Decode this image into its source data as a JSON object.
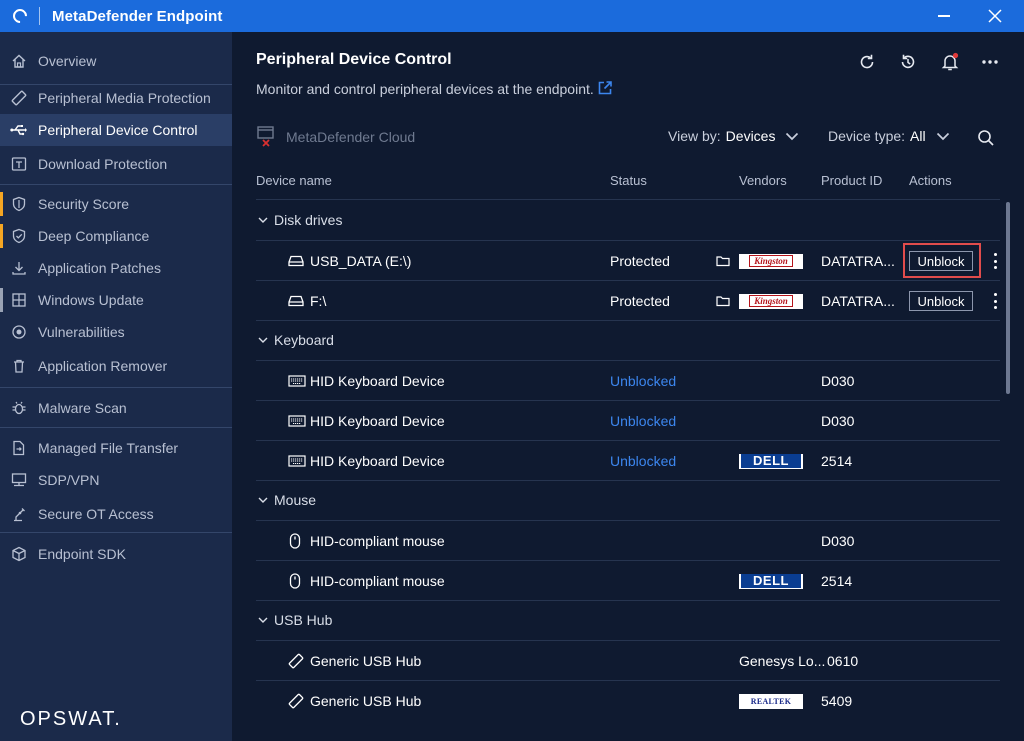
{
  "app": {
    "title": "MetaDefender Endpoint",
    "brand": "OPSWAT."
  },
  "sidebar": {
    "items": [
      {
        "label": "Overview",
        "icon": "home-icon"
      },
      {
        "label": "Peripheral Media Protection",
        "icon": "usb-stick-icon"
      },
      {
        "label": "Peripheral Device Control",
        "icon": "usb-symbol-icon",
        "active": true
      },
      {
        "label": "Download Protection",
        "icon": "download-shield-icon"
      },
      {
        "label": "Security Score",
        "icon": "shield-icon",
        "flag": "#f5a623"
      },
      {
        "label": "Deep Compliance",
        "icon": "check-shield-icon",
        "flag": "#f5a623"
      },
      {
        "label": "Application Patches",
        "icon": "download-icon"
      },
      {
        "label": "Windows Update",
        "icon": "windows-icon",
        "flag": "#9aa3b5"
      },
      {
        "label": "Vulnerabilities",
        "icon": "bug-target-icon"
      },
      {
        "label": "Application Remover",
        "icon": "trash-icon"
      },
      {
        "label": "Malware Scan",
        "icon": "bug-icon"
      },
      {
        "label": "Managed File Transfer",
        "icon": "file-transfer-icon"
      },
      {
        "label": "SDP/VPN",
        "icon": "monitor-network-icon"
      },
      {
        "label": "Secure OT Access",
        "icon": "robot-arm-icon"
      },
      {
        "label": "Endpoint SDK",
        "icon": "cube-icon"
      }
    ]
  },
  "main": {
    "title": "Peripheral Device Control",
    "subtitle": "Monitor and control peripheral devices at the endpoint.",
    "cloud_label": "MetaDefender Cloud",
    "view_by": {
      "label": "View by:",
      "value": "Devices"
    },
    "device_type": {
      "label": "Device type:",
      "value": "All"
    },
    "columns": {
      "name": "Device name",
      "status": "Status",
      "vendors": "Vendors",
      "product_id": "Product ID",
      "actions": "Actions"
    },
    "groups": [
      {
        "label": "Disk drives"
      },
      {
        "label": "Keyboard"
      },
      {
        "label": "Mouse"
      },
      {
        "label": "USB Hub"
      }
    ],
    "rows": [
      {
        "name": "USB_DATA (E:\\)",
        "status": "Protected",
        "vendor_logo": "Kingston",
        "product_id": "DATATRA...",
        "action": "Unblock"
      },
      {
        "name": "F:\\",
        "status": "Protected",
        "vendor_logo": "Kingston",
        "product_id": "DATATRA...",
        "action": "Unblock"
      },
      {
        "name": "HID Keyboard Device",
        "status": "Unblocked",
        "product_id": "D030"
      },
      {
        "name": "HID Keyboard Device",
        "status": "Unblocked",
        "product_id": "D030"
      },
      {
        "name": "HID Keyboard Device",
        "status": "Unblocked",
        "vendor_logo": "DELL",
        "product_id": "2514"
      },
      {
        "name": "HID-compliant mouse",
        "product_id": "D030"
      },
      {
        "name": "HID-compliant mouse",
        "vendor_logo": "DELL",
        "product_id": "2514"
      },
      {
        "name": "Generic USB Hub",
        "vendor_text": "Genesys Lo...",
        "product_id": "0610"
      },
      {
        "name": "Generic USB Hub",
        "vendor_logo": "REALTEK",
        "product_id": "5409"
      }
    ]
  },
  "colors": {
    "titlebar": "#1b6bdc",
    "sidebar": "#1b2a4a",
    "main": "#0f1a30",
    "link": "#3c86ee",
    "highlight": "#e14c4c"
  }
}
